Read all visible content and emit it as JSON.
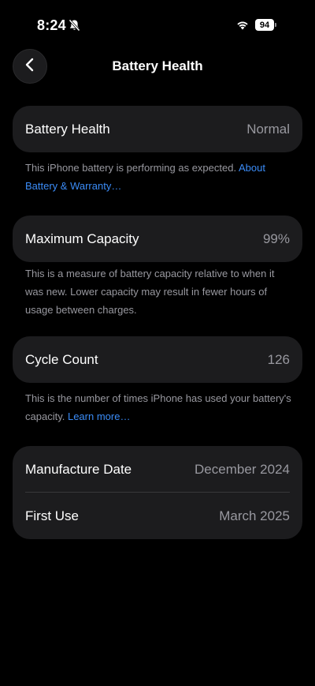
{
  "status_bar": {
    "time": "8:24",
    "battery_level": "94",
    "icons": [
      "bell-slash-icon",
      "wifi-icon",
      "battery-icon"
    ]
  },
  "nav": {
    "title": "Battery Health",
    "back_icon": "chevron-left-icon"
  },
  "battery_health": {
    "label": "Battery Health",
    "value": "Normal",
    "note": "This iPhone battery is performing as expected.",
    "link": "About Battery & Warranty…"
  },
  "maximum_capacity": {
    "label": "Maximum Capacity",
    "value": "99%",
    "note": "This is a measure of battery capacity relative to when it was new. Lower capacity may result in fewer hours of usage between charges."
  },
  "cycle_count": {
    "label": "Cycle Count",
    "value": "126",
    "note": "This is the number of times iPhone has used your battery's capacity.",
    "link": "Learn more…"
  },
  "dates": {
    "manufacture_label": "Manufacture Date",
    "manufacture_value": "December 2024",
    "first_use_label": "First Use",
    "first_use_value": "March 2025"
  },
  "colors": {
    "background": "#000000",
    "card": "#1c1c1e",
    "secondary_text": "#98989f",
    "link": "#3b8cf7"
  }
}
